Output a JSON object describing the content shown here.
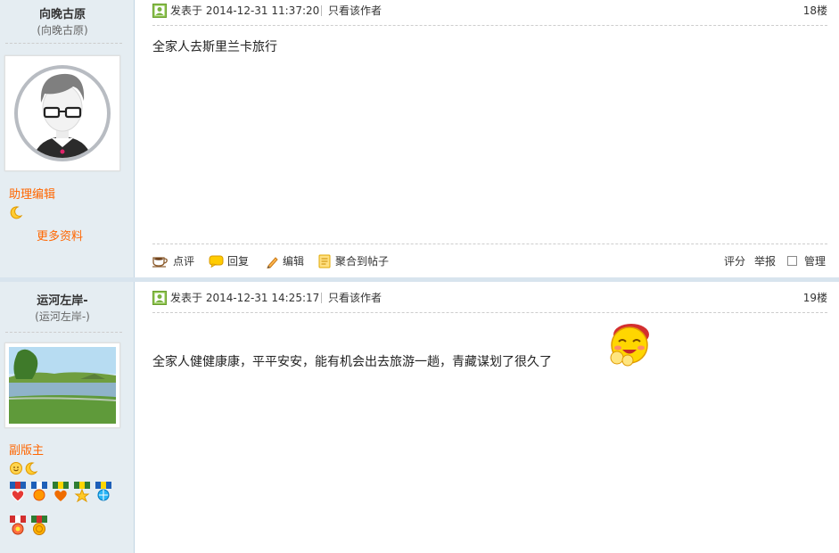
{
  "posts": [
    {
      "username": "向晚古原",
      "username_sub": "(向晚古原)",
      "role": "助理编辑",
      "more_profile": "更多资料",
      "posted": "发表于 2014-12-31 11:37:20",
      "only_author": "只看该作者",
      "floor": "18楼",
      "content": "全家人去斯里兰卡旅行",
      "actions": {
        "comment": "点评",
        "reply": "回复",
        "edit": "编辑",
        "aggregate": "聚合到帖子",
        "rate": "评分",
        "report": "举报",
        "manage": "管理"
      },
      "avatar": "default-avatar-icon",
      "level_icons": [
        "moon-icon"
      ]
    },
    {
      "username": "运河左岸-",
      "username_sub": "(运河左岸-)",
      "role": "副版主",
      "posted": "发表于 2014-12-31 14:25:17",
      "only_author": "只看该作者",
      "floor": "19楼",
      "content": "全家人健健康康，平平安安，能有机会出去旅游一趟，青藏谋划了很久了",
      "avatar": "landscape-photo",
      "level_icons": [
        "sun-icon",
        "moon-icon"
      ],
      "medals": [
        "heart-medal",
        "sun-medal",
        "heart-medal",
        "star-medal",
        "globe-medal",
        "flower-medal",
        "coin-medal"
      ]
    }
  ],
  "colors": {
    "sidebar_bg": "#e5edf2",
    "role": "#ff6600",
    "separator": "#d8e4ee"
  }
}
